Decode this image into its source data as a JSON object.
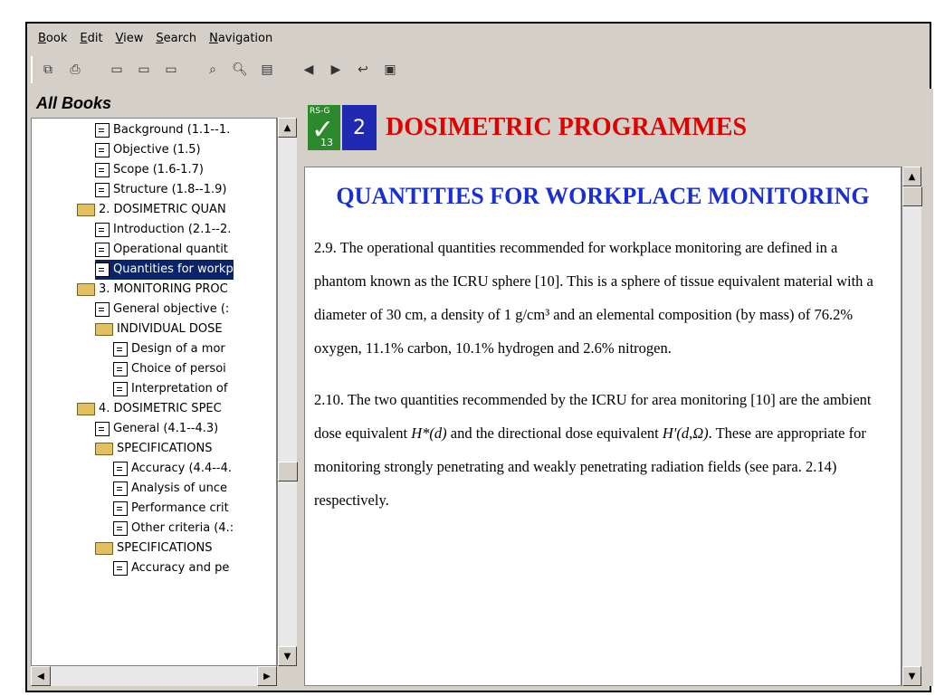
{
  "menu": [
    "Book",
    "Edit",
    "View",
    "Search",
    "Navigation"
  ],
  "toolbar_icons": [
    "copy-icon",
    "print-icon",
    "pane1-icon",
    "pane2-icon",
    "pane3-icon",
    "find-icon",
    "zoom-icon",
    "bookmark-icon",
    "back-icon",
    "forward-icon",
    "history-icon",
    "goto-icon"
  ],
  "left": {
    "title": "All Books",
    "tree": [
      {
        "label": "Background (1.1--1.",
        "type": "doc",
        "indent": 1
      },
      {
        "label": "Objective (1.5)",
        "type": "doc",
        "indent": 1
      },
      {
        "label": "Scope (1.6-1.7)",
        "type": "doc",
        "indent": 1
      },
      {
        "label": "Structure (1.8--1.9)",
        "type": "doc",
        "indent": 1
      },
      {
        "label": "2. DOSIMETRIC QUAN",
        "type": "folder",
        "indent": 0
      },
      {
        "label": "Introduction (2.1--2.",
        "type": "doc",
        "indent": 1
      },
      {
        "label": "Operational quantit",
        "type": "doc",
        "indent": 1
      },
      {
        "label": "Quantities for workp",
        "type": "doc",
        "indent": 1,
        "selected": true
      },
      {
        "label": "3. MONITORING PROC",
        "type": "folder",
        "indent": 0
      },
      {
        "label": "General objective (:",
        "type": "doc",
        "indent": 1
      },
      {
        "label": "INDIVIDUAL DOSE",
        "type": "folder",
        "indent": 1
      },
      {
        "label": "Design of a mor",
        "type": "doc",
        "indent": 2
      },
      {
        "label": "Choice of persoi",
        "type": "doc",
        "indent": 2
      },
      {
        "label": "Interpretation of",
        "type": "doc",
        "indent": 2
      },
      {
        "label": "4. DOSIMETRIC SPEC",
        "type": "folder",
        "indent": 0
      },
      {
        "label": "General (4.1--4.3)",
        "type": "doc",
        "indent": 1
      },
      {
        "label": "SPECIFICATIONS",
        "type": "folder",
        "indent": 1
      },
      {
        "label": "Accuracy (4.4--4.",
        "type": "doc",
        "indent": 2
      },
      {
        "label": "Analysis of unce",
        "type": "doc",
        "indent": 2
      },
      {
        "label": "Performance crit",
        "type": "doc",
        "indent": 2
      },
      {
        "label": "Other criteria (4.:",
        "type": "doc",
        "indent": 2
      },
      {
        "label": "SPECIFICATIONS",
        "type": "folder",
        "indent": 1
      },
      {
        "label": "Accuracy and pe",
        "type": "doc",
        "indent": 2
      }
    ]
  },
  "right": {
    "logo1": {
      "text": "RS-G",
      "num": "13"
    },
    "logo2": {
      "text": "2"
    },
    "banner_title": "DOSIMETRIC PROGRAMMES",
    "heading": "QUANTITIES FOR WORKPLACE MONITORING",
    "para1": "2.9.     The operational quantities recommended for workplace monitoring are defined in a phantom known as the ICRU sphere [10]. This is a sphere of tissue equivalent material with a diameter of 30 cm, a density of 1 g/cm³ and an elemental composition (by mass) of 76.2% oxygen, 11.1% carbon, 10.1% hydrogen and 2.6% nitrogen.",
    "para2_pre": "2.10.   The two quantities recommended by the ICRU for area monitoring [10] are the ambient dose equivalent ",
    "para2_h": "H*(d)",
    "para2_mid": " and the directional dose equivalent ",
    "para2_h2": "H'(d,Ω)",
    "para2_post": ". These are appropriate for monitoring strongly penetrating and weakly penetrating radiation fields (see para. 2.14) respectively."
  }
}
